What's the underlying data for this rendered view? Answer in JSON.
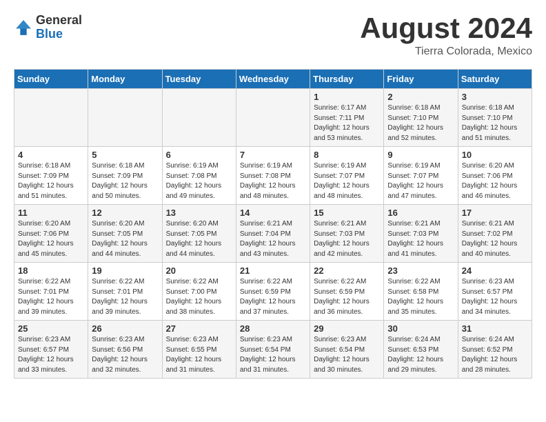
{
  "header": {
    "logo": {
      "general": "General",
      "blue": "Blue"
    },
    "title": "August 2024",
    "location": "Tierra Colorada, Mexico"
  },
  "calendar": {
    "days_of_week": [
      "Sunday",
      "Monday",
      "Tuesday",
      "Wednesday",
      "Thursday",
      "Friday",
      "Saturday"
    ],
    "weeks": [
      [
        {
          "day": "",
          "info": ""
        },
        {
          "day": "",
          "info": ""
        },
        {
          "day": "",
          "info": ""
        },
        {
          "day": "",
          "info": ""
        },
        {
          "day": "1",
          "info": "Sunrise: 6:17 AM\nSunset: 7:11 PM\nDaylight: 12 hours\nand 53 minutes."
        },
        {
          "day": "2",
          "info": "Sunrise: 6:18 AM\nSunset: 7:10 PM\nDaylight: 12 hours\nand 52 minutes."
        },
        {
          "day": "3",
          "info": "Sunrise: 6:18 AM\nSunset: 7:10 PM\nDaylight: 12 hours\nand 51 minutes."
        }
      ],
      [
        {
          "day": "4",
          "info": "Sunrise: 6:18 AM\nSunset: 7:09 PM\nDaylight: 12 hours\nand 51 minutes."
        },
        {
          "day": "5",
          "info": "Sunrise: 6:18 AM\nSunset: 7:09 PM\nDaylight: 12 hours\nand 50 minutes."
        },
        {
          "day": "6",
          "info": "Sunrise: 6:19 AM\nSunset: 7:08 PM\nDaylight: 12 hours\nand 49 minutes."
        },
        {
          "day": "7",
          "info": "Sunrise: 6:19 AM\nSunset: 7:08 PM\nDaylight: 12 hours\nand 48 minutes."
        },
        {
          "day": "8",
          "info": "Sunrise: 6:19 AM\nSunset: 7:07 PM\nDaylight: 12 hours\nand 48 minutes."
        },
        {
          "day": "9",
          "info": "Sunrise: 6:19 AM\nSunset: 7:07 PM\nDaylight: 12 hours\nand 47 minutes."
        },
        {
          "day": "10",
          "info": "Sunrise: 6:20 AM\nSunset: 7:06 PM\nDaylight: 12 hours\nand 46 minutes."
        }
      ],
      [
        {
          "day": "11",
          "info": "Sunrise: 6:20 AM\nSunset: 7:06 PM\nDaylight: 12 hours\nand 45 minutes."
        },
        {
          "day": "12",
          "info": "Sunrise: 6:20 AM\nSunset: 7:05 PM\nDaylight: 12 hours\nand 44 minutes."
        },
        {
          "day": "13",
          "info": "Sunrise: 6:20 AM\nSunset: 7:05 PM\nDaylight: 12 hours\nand 44 minutes."
        },
        {
          "day": "14",
          "info": "Sunrise: 6:21 AM\nSunset: 7:04 PM\nDaylight: 12 hours\nand 43 minutes."
        },
        {
          "day": "15",
          "info": "Sunrise: 6:21 AM\nSunset: 7:03 PM\nDaylight: 12 hours\nand 42 minutes."
        },
        {
          "day": "16",
          "info": "Sunrise: 6:21 AM\nSunset: 7:03 PM\nDaylight: 12 hours\nand 41 minutes."
        },
        {
          "day": "17",
          "info": "Sunrise: 6:21 AM\nSunset: 7:02 PM\nDaylight: 12 hours\nand 40 minutes."
        }
      ],
      [
        {
          "day": "18",
          "info": "Sunrise: 6:22 AM\nSunset: 7:01 PM\nDaylight: 12 hours\nand 39 minutes."
        },
        {
          "day": "19",
          "info": "Sunrise: 6:22 AM\nSunset: 7:01 PM\nDaylight: 12 hours\nand 39 minutes."
        },
        {
          "day": "20",
          "info": "Sunrise: 6:22 AM\nSunset: 7:00 PM\nDaylight: 12 hours\nand 38 minutes."
        },
        {
          "day": "21",
          "info": "Sunrise: 6:22 AM\nSunset: 6:59 PM\nDaylight: 12 hours\nand 37 minutes."
        },
        {
          "day": "22",
          "info": "Sunrise: 6:22 AM\nSunset: 6:59 PM\nDaylight: 12 hours\nand 36 minutes."
        },
        {
          "day": "23",
          "info": "Sunrise: 6:22 AM\nSunset: 6:58 PM\nDaylight: 12 hours\nand 35 minutes."
        },
        {
          "day": "24",
          "info": "Sunrise: 6:23 AM\nSunset: 6:57 PM\nDaylight: 12 hours\nand 34 minutes."
        }
      ],
      [
        {
          "day": "25",
          "info": "Sunrise: 6:23 AM\nSunset: 6:57 PM\nDaylight: 12 hours\nand 33 minutes."
        },
        {
          "day": "26",
          "info": "Sunrise: 6:23 AM\nSunset: 6:56 PM\nDaylight: 12 hours\nand 32 minutes."
        },
        {
          "day": "27",
          "info": "Sunrise: 6:23 AM\nSunset: 6:55 PM\nDaylight: 12 hours\nand 31 minutes."
        },
        {
          "day": "28",
          "info": "Sunrise: 6:23 AM\nSunset: 6:54 PM\nDaylight: 12 hours\nand 31 minutes."
        },
        {
          "day": "29",
          "info": "Sunrise: 6:23 AM\nSunset: 6:54 PM\nDaylight: 12 hours\nand 30 minutes."
        },
        {
          "day": "30",
          "info": "Sunrise: 6:24 AM\nSunset: 6:53 PM\nDaylight: 12 hours\nand 29 minutes."
        },
        {
          "day": "31",
          "info": "Sunrise: 6:24 AM\nSunset: 6:52 PM\nDaylight: 12 hours\nand 28 minutes."
        }
      ]
    ]
  }
}
